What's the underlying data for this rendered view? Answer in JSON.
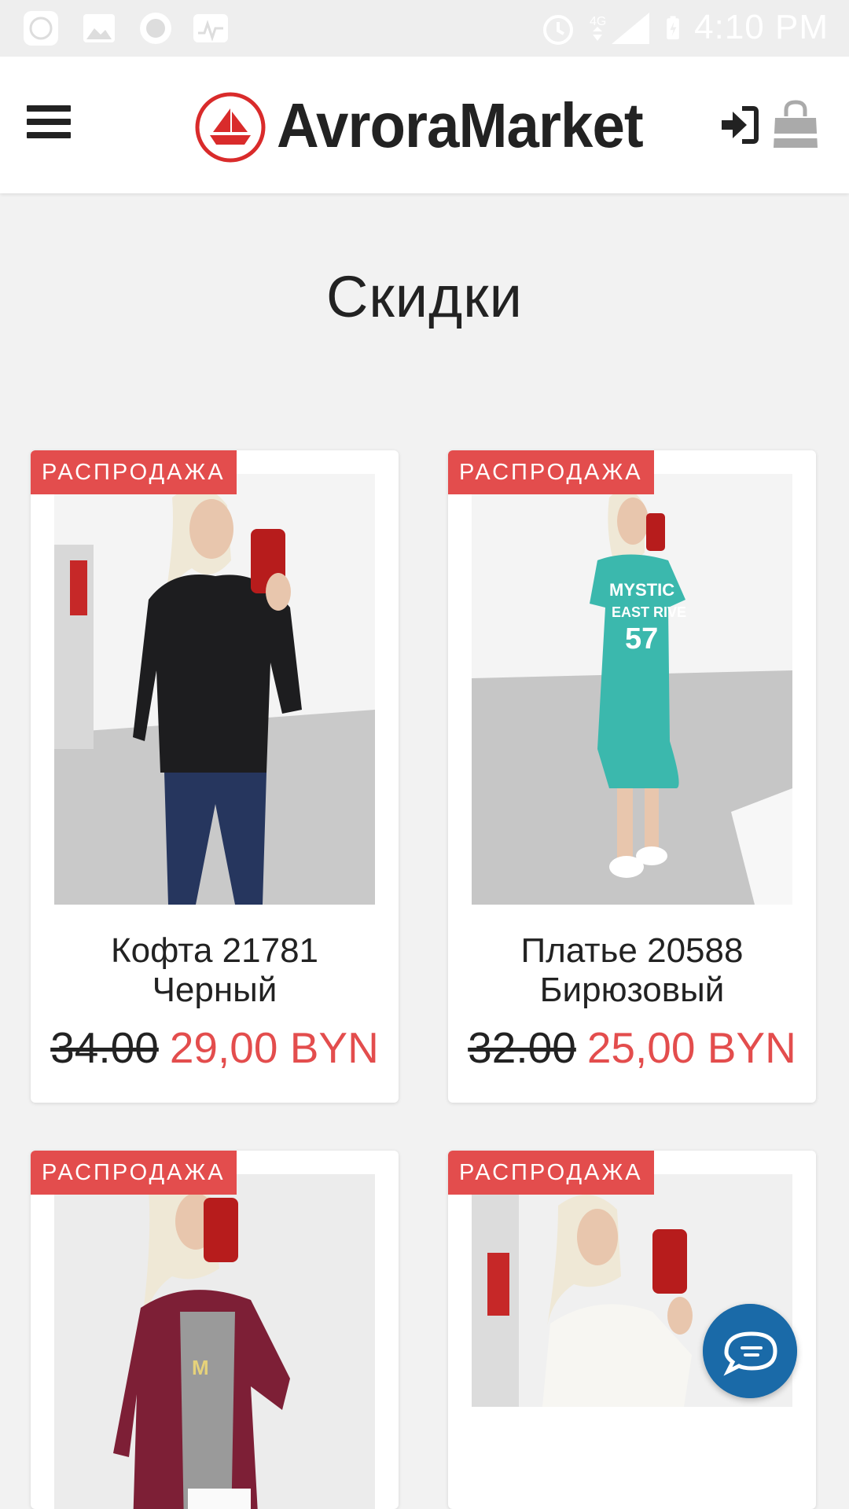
{
  "status_bar": {
    "time": "4:10 PM",
    "network": "4G"
  },
  "header": {
    "brand": "AvroraMarket"
  },
  "page": {
    "title": "Скидки"
  },
  "products": [
    {
      "badge": "РАСПРОДАЖА",
      "name_line1": "Кофта 21781",
      "name_line2": "Черный",
      "old_price": "34.00",
      "new_price": "29,00 BYN"
    },
    {
      "badge": "РАСПРОДАЖА",
      "name_line1": "Платье 20588",
      "name_line2": "Бирюзовый",
      "old_price": "32.00",
      "new_price": "25,00 BYN"
    },
    {
      "badge": "РАСПРОДАЖА"
    },
    {
      "badge": "РАСПРОДАЖА"
    }
  ],
  "colors": {
    "accent": "#e34d4d",
    "chat": "#1a6aa8",
    "text": "#222222"
  },
  "icons": [
    "menu-icon",
    "logo-ship-icon",
    "login-icon",
    "shopping-bag-icon",
    "chat-icon",
    "alarm-icon",
    "signal-icon",
    "battery-icon"
  ]
}
